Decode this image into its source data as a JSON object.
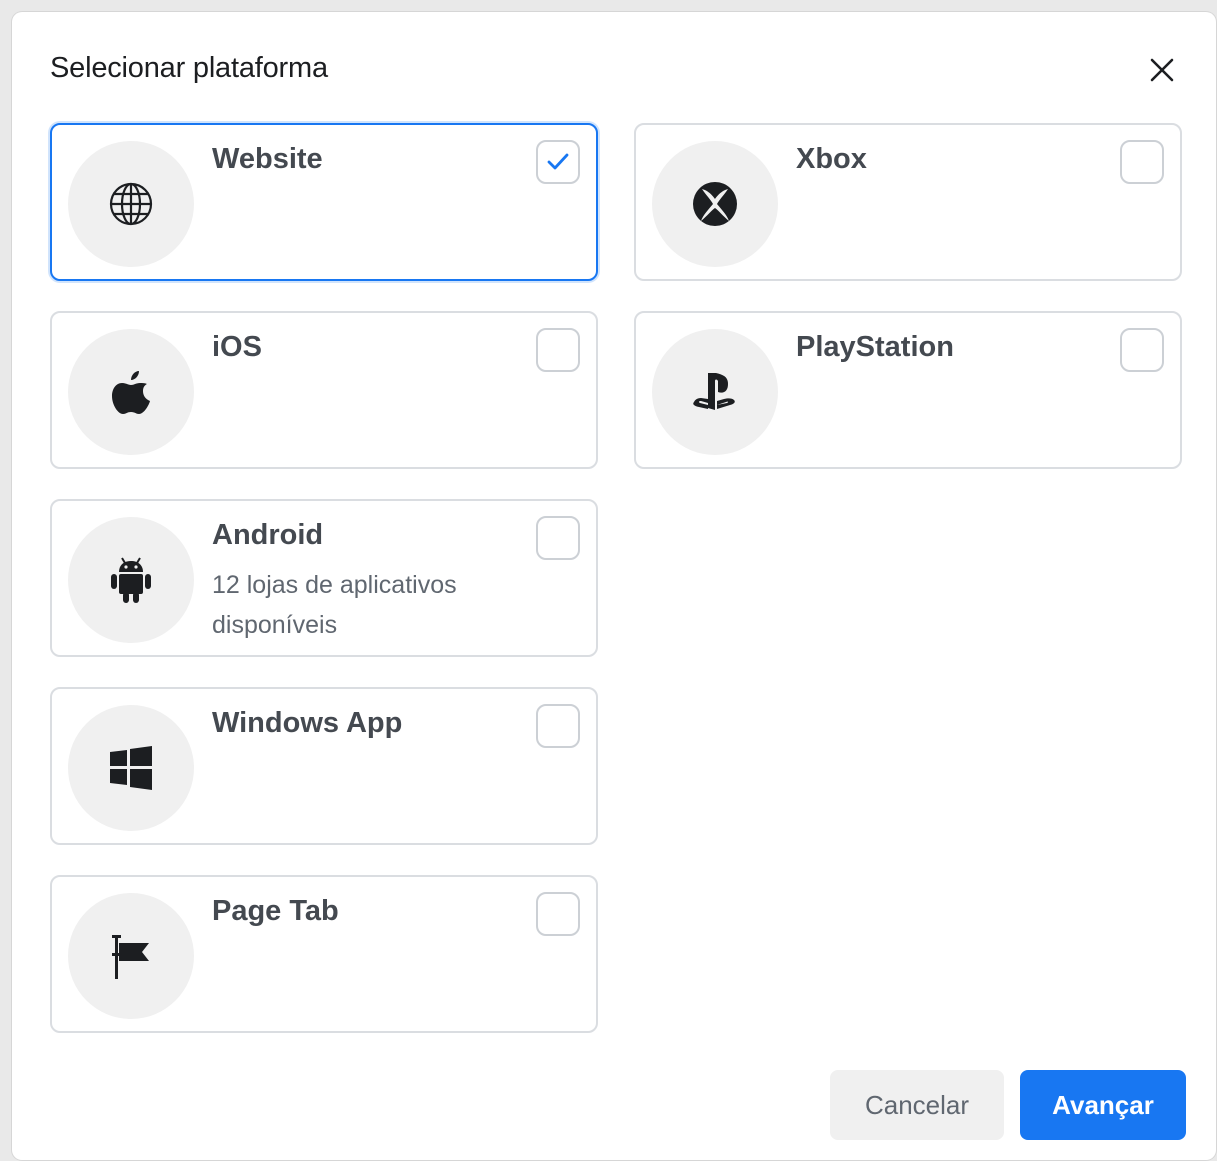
{
  "dialog": {
    "title": "Selecionar plataforma",
    "close_icon": "close-icon"
  },
  "platforms": [
    {
      "label": "Website",
      "sublabel": "",
      "icon": "globe-icon",
      "checked": true
    },
    {
      "label": "Xbox",
      "sublabel": "",
      "icon": "xbox-icon",
      "checked": false
    },
    {
      "label": "iOS",
      "sublabel": "",
      "icon": "apple-icon",
      "checked": false
    },
    {
      "label": "PlayStation",
      "sublabel": "",
      "icon": "playstation-icon",
      "checked": false
    },
    {
      "label": "Android",
      "sublabel": "12 lojas de aplicativos disponíveis",
      "icon": "android-icon",
      "checked": false
    },
    {
      "label": "Windows App",
      "sublabel": "",
      "icon": "windows-icon",
      "checked": false
    },
    {
      "label": "Page Tab",
      "sublabel": "",
      "icon": "flag-icon",
      "checked": false
    }
  ],
  "footer": {
    "cancel_label": "Cancelar",
    "next_label": "Avançar"
  },
  "colors": {
    "accent": "#1877f2",
    "card_border": "#dadde1",
    "icon_bg": "#f0f0f0",
    "text": "#1c1e21"
  }
}
